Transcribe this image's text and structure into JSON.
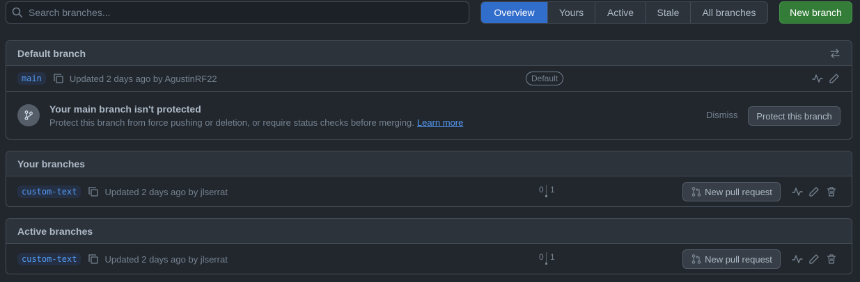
{
  "search": {
    "placeholder": "Search branches..."
  },
  "tabs": [
    {
      "label": "Overview",
      "active": true
    },
    {
      "label": "Yours",
      "active": false
    },
    {
      "label": "Active",
      "active": false
    },
    {
      "label": "Stale",
      "active": false
    },
    {
      "label": "All branches",
      "active": false
    }
  ],
  "new_branch_label": "New branch",
  "default_section": {
    "title": "Default branch",
    "branch": "main",
    "updated": "Updated 2 days ago by AgustinRF22",
    "badge": "Default",
    "notice": {
      "title": "Your main branch isn't protected",
      "description": "Protect this branch from force pushing or deletion, or require status checks before merging.",
      "link": "Learn more",
      "dismiss": "Dismiss",
      "protect_button": "Protect this branch"
    }
  },
  "your_section": {
    "title": "Your branches",
    "branch": "custom-text",
    "updated": "Updated 2 days ago by jlserrat",
    "behind": "0",
    "ahead": "1",
    "pr_button": "New pull request"
  },
  "active_section": {
    "title": "Active branches",
    "branch": "custom-text",
    "updated": "Updated 2 days ago by jlserrat",
    "behind": "0",
    "ahead": "1",
    "pr_button": "New pull request"
  },
  "colors": {
    "background": "#22272e",
    "accent": "#316dca",
    "primary_button": "#347d39",
    "link": "#539bf5"
  }
}
